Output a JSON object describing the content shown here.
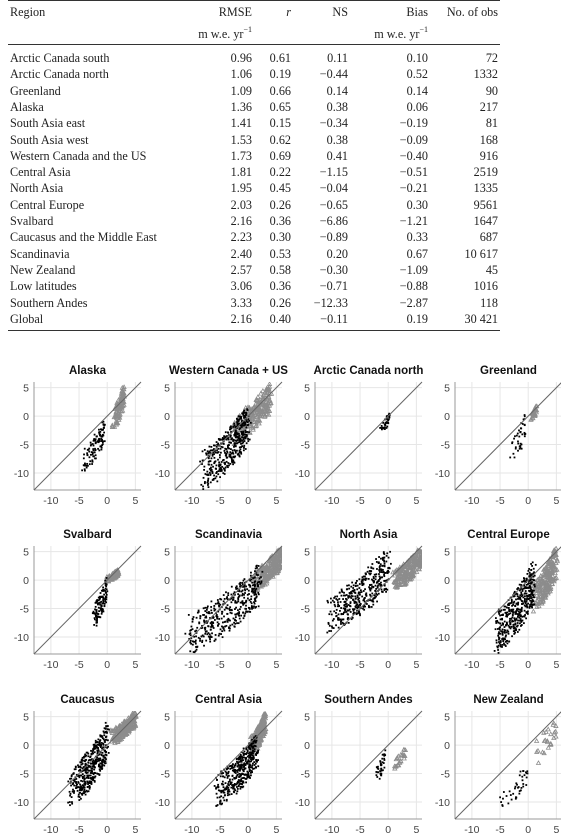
{
  "table": {
    "headers": {
      "region": "Region",
      "rmse": "RMSE",
      "rmse_unit": "m w.e. yr",
      "rmse_unit_exp": "−1",
      "r": "r",
      "ns": "NS",
      "bias": "Bias",
      "bias_unit": "m w.e. yr",
      "bias_unit_exp": "−1",
      "obs": "No. of obs"
    },
    "rows": [
      {
        "region": "Arctic Canada south",
        "rmse": "0.96",
        "r": "0.61",
        "ns": "0.11",
        "bias": "0.10",
        "obs": "72"
      },
      {
        "region": "Arctic Canada north",
        "rmse": "1.06",
        "r": "0.19",
        "ns": "−0.44",
        "bias": "0.52",
        "obs": "1332"
      },
      {
        "region": "Greenland",
        "rmse": "1.09",
        "r": "0.66",
        "ns": "0.14",
        "bias": "0.14",
        "obs": "90"
      },
      {
        "region": "Alaska",
        "rmse": "1.36",
        "r": "0.65",
        "ns": "0.38",
        "bias": "0.06",
        "obs": "217"
      },
      {
        "region": "South Asia east",
        "rmse": "1.41",
        "r": "0.15",
        "ns": "−0.34",
        "bias": "−0.19",
        "obs": "81"
      },
      {
        "region": "South Asia west",
        "rmse": "1.53",
        "r": "0.62",
        "ns": "0.38",
        "bias": "−0.09",
        "obs": "168"
      },
      {
        "region": "Western Canada and the US",
        "rmse": "1.73",
        "r": "0.69",
        "ns": "0.41",
        "bias": "−0.40",
        "obs": "916"
      },
      {
        "region": "Central Asia",
        "rmse": "1.81",
        "r": "0.22",
        "ns": "−1.15",
        "bias": "−0.51",
        "obs": "2519"
      },
      {
        "region": "North Asia",
        "rmse": "1.95",
        "r": "0.45",
        "ns": "−0.04",
        "bias": "−0.21",
        "obs": "1335"
      },
      {
        "region": "Central Europe",
        "rmse": "2.03",
        "r": "0.26",
        "ns": "−0.65",
        "bias": "0.30",
        "obs": "9561"
      },
      {
        "region": "Svalbard",
        "rmse": "2.16",
        "r": "0.36",
        "ns": "−6.86",
        "bias": "−1.21",
        "obs": "1647"
      },
      {
        "region": "Caucasus and the Middle East",
        "rmse": "2.23",
        "r": "0.30",
        "ns": "−0.89",
        "bias": "0.33",
        "obs": "687"
      },
      {
        "region": "Scandinavia",
        "rmse": "2.40",
        "r": "0.53",
        "ns": "0.20",
        "bias": "0.67",
        "obs": "10 617"
      },
      {
        "region": "New Zealand",
        "rmse": "2.57",
        "r": "0.58",
        "ns": "−0.30",
        "bias": "−1.09",
        "obs": "45"
      },
      {
        "region": "Low latitudes",
        "rmse": "3.06",
        "r": "0.36",
        "ns": "−0.71",
        "bias": "−0.88",
        "obs": "1016"
      },
      {
        "region": "Southern Andes",
        "rmse": "3.33",
        "r": "0.26",
        "ns": "−12.33",
        "bias": "−2.87",
        "obs": "118"
      },
      {
        "region": "Global",
        "rmse": "2.16",
        "r": "0.40",
        "ns": "−0.11",
        "bias": "0.19",
        "obs": "30 421"
      }
    ]
  },
  "chart_data": {
    "type": "scatter",
    "description": "Small-multiple scatter plots of modelled vs observed mass balance per region with 1:1 line",
    "xlim": [
      -13,
      6
    ],
    "ylim": [
      -13,
      6
    ],
    "xticks": [
      -10,
      -5,
      0,
      5
    ],
    "yticks": [
      -10,
      -5,
      0,
      5
    ],
    "xtick_labels": [
      "-10",
      "-5",
      "0",
      "5"
    ],
    "ytick_labels": [
      "-10",
      "-5",
      "0",
      "5"
    ],
    "grid": true,
    "reference_line": "1:1 diagonal",
    "colors": {
      "negative_points": "#000000",
      "positive_points": "#8c8c8c",
      "line": "#666666",
      "grid": "#e6e6e6",
      "axis": "#999999"
    },
    "panels": [
      {
        "title": "Alaska",
        "neg_cluster": {
          "x": [
            -5,
            -0.5
          ],
          "y": [
            -10,
            -0.5
          ]
        },
        "pos_cluster": {
          "x": [
            0.5,
            3
          ],
          "y": [
            -3,
            6
          ]
        }
      },
      {
        "title": "Western Canada + US",
        "neg_cluster": {
          "x": [
            -10,
            0
          ],
          "y": [
            -13,
            2
          ]
        },
        "pos_cluster": {
          "x": [
            -4,
            4
          ],
          "y": [
            -5,
            6
          ]
        }
      },
      {
        "title": "Arctic Canada north",
        "neg_cluster": {
          "x": [
            -1.8,
            0.2
          ],
          "y": [
            -3.5,
            0.7
          ]
        },
        "pos_cluster": null
      },
      {
        "title": "Greenland",
        "neg_cluster": {
          "x": [
            -4,
            -0.5
          ],
          "y": [
            -9.3,
            0.7
          ]
        },
        "pos_cluster": {
          "x": [
            0.3,
            1.5
          ],
          "y": [
            -1,
            2
          ]
        }
      },
      {
        "title": "Svalbard",
        "neg_cluster": {
          "x": [
            -3,
            0
          ],
          "y": [
            -8.8,
            1
          ]
        },
        "pos_cluster": {
          "x": [
            -0.5,
            2
          ],
          "y": [
            -0.5,
            2
          ]
        }
      },
      {
        "title": "Scandinavia",
        "neg_cluster": {
          "x": [
            -13,
            2
          ],
          "y": [
            -13,
            3
          ]
        },
        "pos_cluster": {
          "x": [
            0,
            6
          ],
          "y": [
            -2,
            6
          ]
        }
      },
      {
        "title": "North Asia",
        "neg_cluster": {
          "x": [
            -13,
            0
          ],
          "y": [
            -9.5,
            5.5
          ]
        },
        "pos_cluster": {
          "x": [
            0,
            6
          ],
          "y": [
            -2,
            6
          ]
        }
      },
      {
        "title": "Central Europe",
        "neg_cluster": {
          "x": [
            -7,
            1
          ],
          "y": [
            -13,
            3.5
          ]
        },
        "pos_cluster": {
          "x": [
            0,
            5
          ],
          "y": [
            -6,
            6
          ]
        }
      },
      {
        "title": "Caucasus",
        "neg_cluster": {
          "x": [
            -8,
            0
          ],
          "y": [
            -11,
            4
          ]
        },
        "pos_cluster": {
          "x": [
            0,
            5
          ],
          "y": [
            0,
            6
          ]
        }
      },
      {
        "title": "Central Asia",
        "neg_cluster": {
          "x": [
            -7,
            1.5
          ],
          "y": [
            -11,
            2
          ]
        },
        "pos_cluster": {
          "x": [
            0,
            3
          ],
          "y": [
            -2,
            6
          ]
        }
      },
      {
        "title": "Southern Andes",
        "neg_cluster": {
          "x": [
            -2.5,
            -0.5
          ],
          "y": [
            -7.3,
            0.2
          ]
        },
        "pos_cluster": {
          "x": [
            0.5,
            3
          ],
          "y": [
            -4.3,
            -0.5
          ]
        }
      },
      {
        "title": "New Zealand",
        "neg_cluster": {
          "x": [
            -6.3,
            -0.3
          ],
          "y": [
            -11.7,
            -3.5
          ]
        },
        "pos_cluster": {
          "x": [
            0.5,
            5
          ],
          "y": [
            -3.5,
            6
          ]
        }
      }
    ]
  }
}
